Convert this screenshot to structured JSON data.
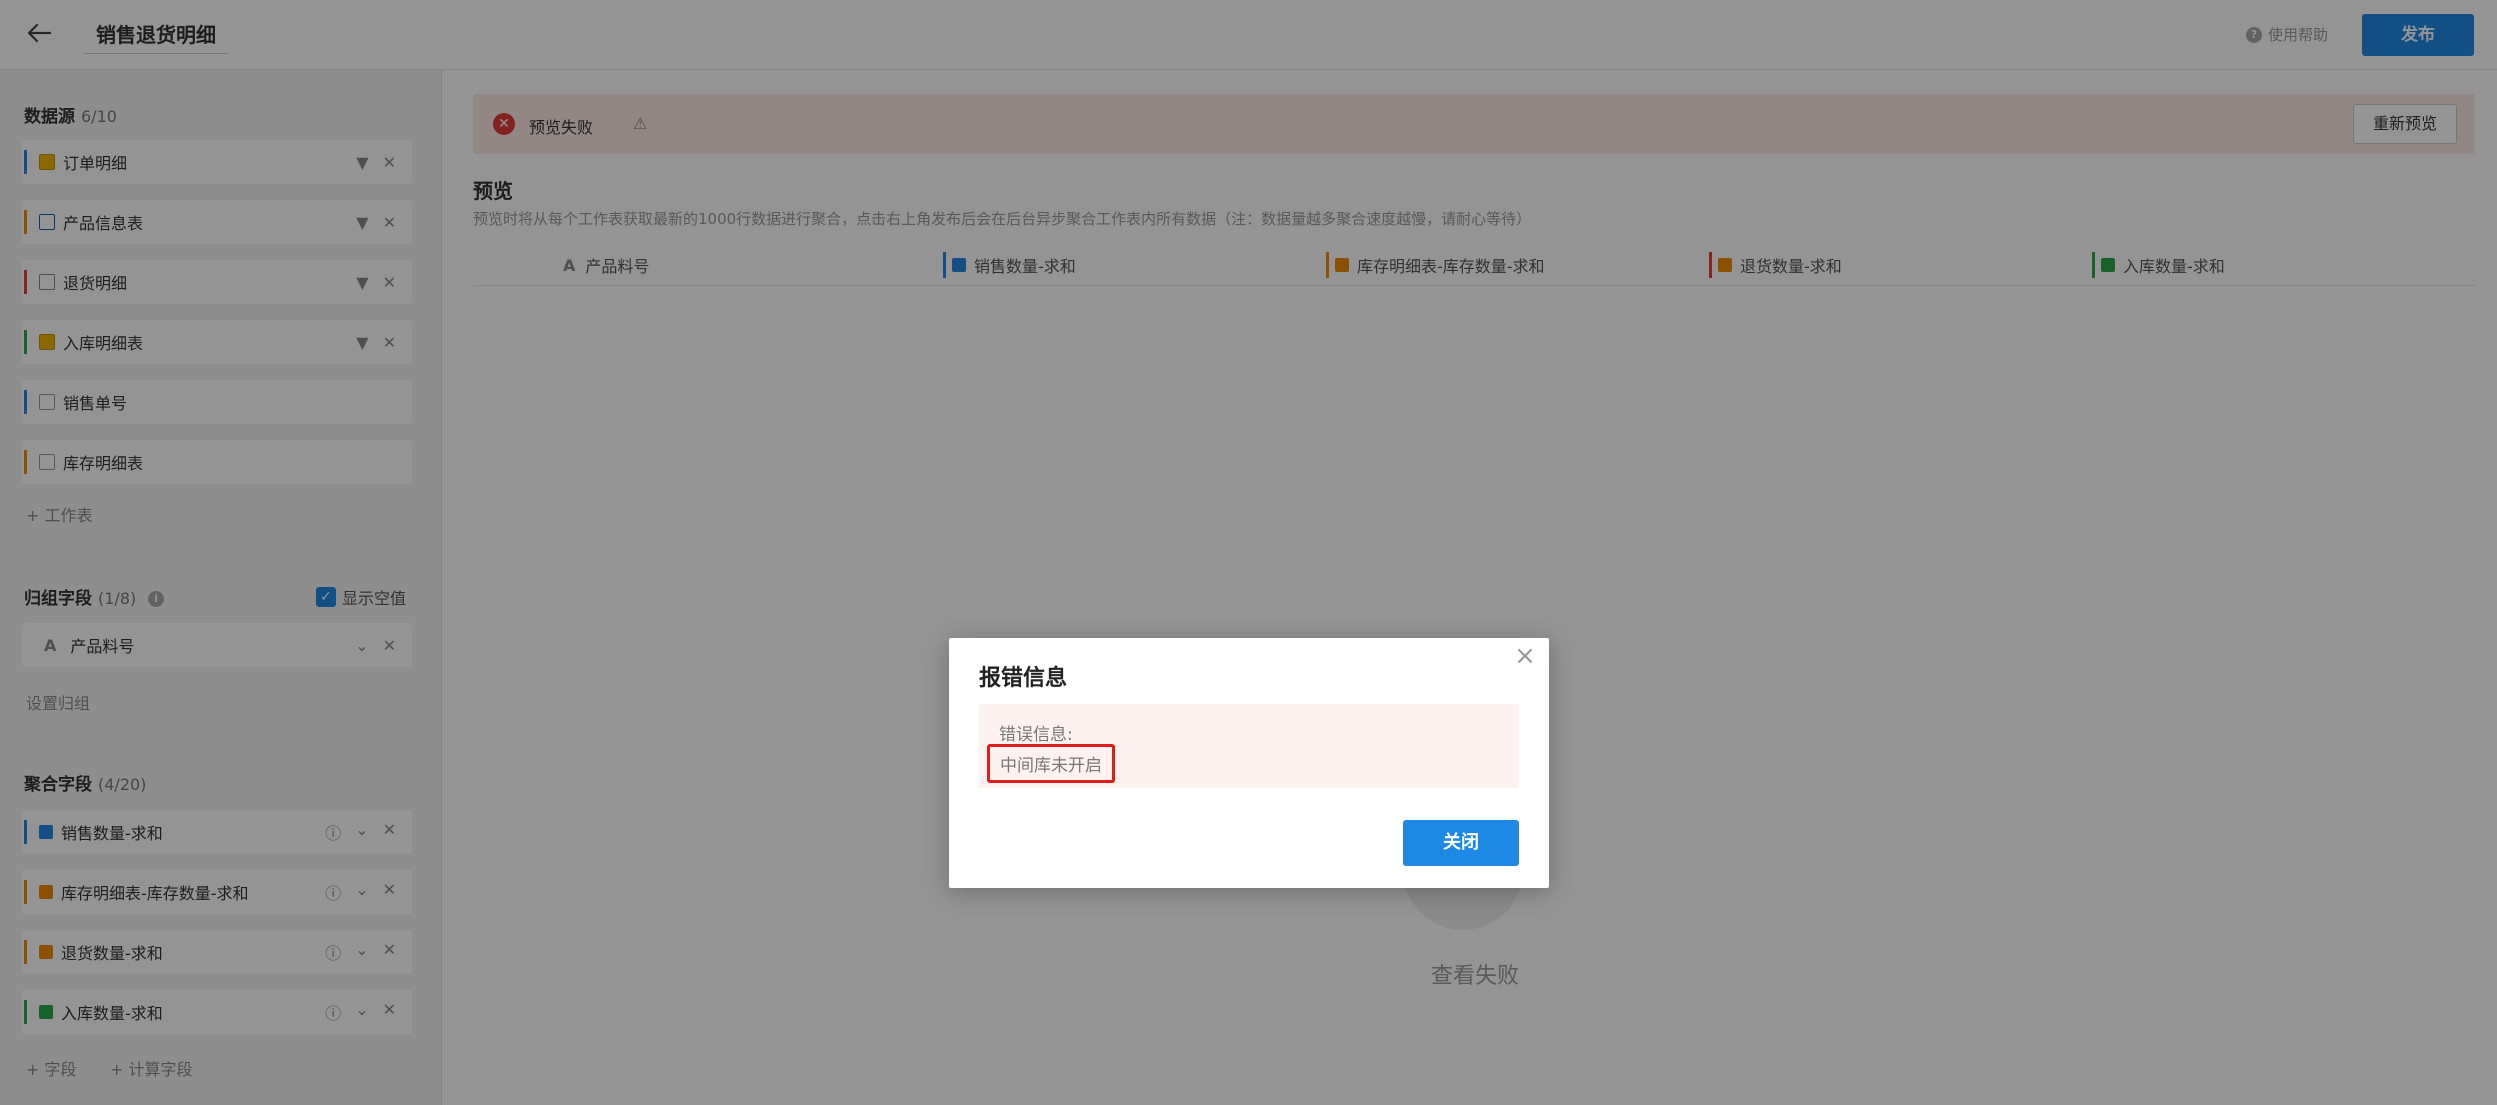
{
  "header": {
    "title": "销售退货明细",
    "help_label": "使用帮助",
    "publish_label": "发布"
  },
  "sidebar": {
    "datasource": {
      "title": "数据源",
      "count": "6/10",
      "items": [
        {
          "label": "订单明细",
          "color": "#f0b400"
        },
        {
          "label": "产品信息表",
          "color": "#f28c00"
        },
        {
          "label": "退货明细",
          "color": "#e53935"
        },
        {
          "label": "入库明细表",
          "color": "#2ba84a"
        },
        {
          "label": "销售单号",
          "color": "#1e88e5"
        },
        {
          "label": "库存明细表",
          "color": "#f28c00"
        }
      ],
      "add_label": "+ 工作表"
    },
    "group": {
      "title": "归组字段",
      "count": "(1/8)",
      "show_empty_label": "显示空值",
      "field": "产品料号",
      "set_label": "设置归组"
    },
    "aggregate": {
      "title": "聚合字段",
      "count": "(4/20)",
      "items": [
        {
          "label": "销售数量-求和",
          "color": "#1e88e5"
        },
        {
          "label": "库存明细表-库存数量-求和",
          "color": "#f28c00"
        },
        {
          "label": "退货数量-求和",
          "color": "#f28c00"
        },
        {
          "label": "入库数量-求和",
          "color": "#2ba84a"
        }
      ],
      "add_field_label": "+ 字段",
      "add_calc_label": "+ 计算字段"
    }
  },
  "main": {
    "banner_msg": "预览失败",
    "repreview_label": "重新预览",
    "preview_title": "预览",
    "preview_desc": "预览时将从每个工作表获取最新的1000行数据进行聚合，点击右上角发布后会在后台异步聚合工作表内所有数据（注：数据量越多聚合速度越慢，请耐心等待）",
    "columns": [
      {
        "label": "产品料号",
        "color": ""
      },
      {
        "label": "销售数量-求和",
        "color": "#1e88e5"
      },
      {
        "label": "库存明细表-库存数量-求和",
        "color": "#f28c00"
      },
      {
        "label": "退货数量-求和",
        "color": "#e53935"
      },
      {
        "label": "入库数量-求和",
        "color": "#2ba84a"
      }
    ],
    "empty_text": "查看失败"
  },
  "modal": {
    "title": "报错信息",
    "error_label": "错误信息:",
    "error_value": "中间库未开启",
    "close_label": "关闭"
  }
}
